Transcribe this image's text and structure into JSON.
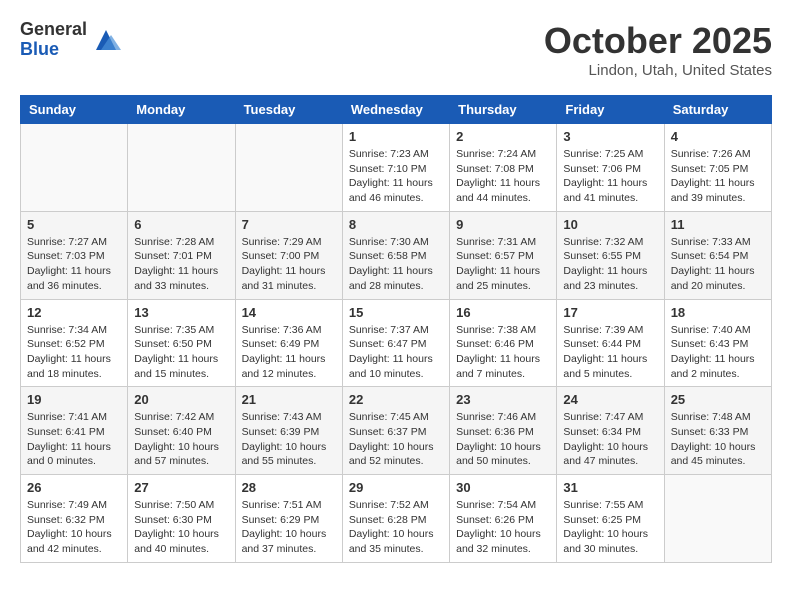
{
  "header": {
    "logo": {
      "general": "General",
      "blue": "Blue"
    },
    "title": "October 2025",
    "location": "Lindon, Utah, United States"
  },
  "weekdays": [
    "Sunday",
    "Monday",
    "Tuesday",
    "Wednesday",
    "Thursday",
    "Friday",
    "Saturday"
  ],
  "weeks": [
    [
      {
        "day": "",
        "info": ""
      },
      {
        "day": "",
        "info": ""
      },
      {
        "day": "",
        "info": ""
      },
      {
        "day": "1",
        "info": "Sunrise: 7:23 AM\nSunset: 7:10 PM\nDaylight: 11 hours and 46 minutes."
      },
      {
        "day": "2",
        "info": "Sunrise: 7:24 AM\nSunset: 7:08 PM\nDaylight: 11 hours and 44 minutes."
      },
      {
        "day": "3",
        "info": "Sunrise: 7:25 AM\nSunset: 7:06 PM\nDaylight: 11 hours and 41 minutes."
      },
      {
        "day": "4",
        "info": "Sunrise: 7:26 AM\nSunset: 7:05 PM\nDaylight: 11 hours and 39 minutes."
      }
    ],
    [
      {
        "day": "5",
        "info": "Sunrise: 7:27 AM\nSunset: 7:03 PM\nDaylight: 11 hours and 36 minutes."
      },
      {
        "day": "6",
        "info": "Sunrise: 7:28 AM\nSunset: 7:01 PM\nDaylight: 11 hours and 33 minutes."
      },
      {
        "day": "7",
        "info": "Sunrise: 7:29 AM\nSunset: 7:00 PM\nDaylight: 11 hours and 31 minutes."
      },
      {
        "day": "8",
        "info": "Sunrise: 7:30 AM\nSunset: 6:58 PM\nDaylight: 11 hours and 28 minutes."
      },
      {
        "day": "9",
        "info": "Sunrise: 7:31 AM\nSunset: 6:57 PM\nDaylight: 11 hours and 25 minutes."
      },
      {
        "day": "10",
        "info": "Sunrise: 7:32 AM\nSunset: 6:55 PM\nDaylight: 11 hours and 23 minutes."
      },
      {
        "day": "11",
        "info": "Sunrise: 7:33 AM\nSunset: 6:54 PM\nDaylight: 11 hours and 20 minutes."
      }
    ],
    [
      {
        "day": "12",
        "info": "Sunrise: 7:34 AM\nSunset: 6:52 PM\nDaylight: 11 hours and 18 minutes."
      },
      {
        "day": "13",
        "info": "Sunrise: 7:35 AM\nSunset: 6:50 PM\nDaylight: 11 hours and 15 minutes."
      },
      {
        "day": "14",
        "info": "Sunrise: 7:36 AM\nSunset: 6:49 PM\nDaylight: 11 hours and 12 minutes."
      },
      {
        "day": "15",
        "info": "Sunrise: 7:37 AM\nSunset: 6:47 PM\nDaylight: 11 hours and 10 minutes."
      },
      {
        "day": "16",
        "info": "Sunrise: 7:38 AM\nSunset: 6:46 PM\nDaylight: 11 hours and 7 minutes."
      },
      {
        "day": "17",
        "info": "Sunrise: 7:39 AM\nSunset: 6:44 PM\nDaylight: 11 hours and 5 minutes."
      },
      {
        "day": "18",
        "info": "Sunrise: 7:40 AM\nSunset: 6:43 PM\nDaylight: 11 hours and 2 minutes."
      }
    ],
    [
      {
        "day": "19",
        "info": "Sunrise: 7:41 AM\nSunset: 6:41 PM\nDaylight: 11 hours and 0 minutes."
      },
      {
        "day": "20",
        "info": "Sunrise: 7:42 AM\nSunset: 6:40 PM\nDaylight: 10 hours and 57 minutes."
      },
      {
        "day": "21",
        "info": "Sunrise: 7:43 AM\nSunset: 6:39 PM\nDaylight: 10 hours and 55 minutes."
      },
      {
        "day": "22",
        "info": "Sunrise: 7:45 AM\nSunset: 6:37 PM\nDaylight: 10 hours and 52 minutes."
      },
      {
        "day": "23",
        "info": "Sunrise: 7:46 AM\nSunset: 6:36 PM\nDaylight: 10 hours and 50 minutes."
      },
      {
        "day": "24",
        "info": "Sunrise: 7:47 AM\nSunset: 6:34 PM\nDaylight: 10 hours and 47 minutes."
      },
      {
        "day": "25",
        "info": "Sunrise: 7:48 AM\nSunset: 6:33 PM\nDaylight: 10 hours and 45 minutes."
      }
    ],
    [
      {
        "day": "26",
        "info": "Sunrise: 7:49 AM\nSunset: 6:32 PM\nDaylight: 10 hours and 42 minutes."
      },
      {
        "day": "27",
        "info": "Sunrise: 7:50 AM\nSunset: 6:30 PM\nDaylight: 10 hours and 40 minutes."
      },
      {
        "day": "28",
        "info": "Sunrise: 7:51 AM\nSunset: 6:29 PM\nDaylight: 10 hours and 37 minutes."
      },
      {
        "day": "29",
        "info": "Sunrise: 7:52 AM\nSunset: 6:28 PM\nDaylight: 10 hours and 35 minutes."
      },
      {
        "day": "30",
        "info": "Sunrise: 7:54 AM\nSunset: 6:26 PM\nDaylight: 10 hours and 32 minutes."
      },
      {
        "day": "31",
        "info": "Sunrise: 7:55 AM\nSunset: 6:25 PM\nDaylight: 10 hours and 30 minutes."
      },
      {
        "day": "",
        "info": ""
      }
    ]
  ]
}
